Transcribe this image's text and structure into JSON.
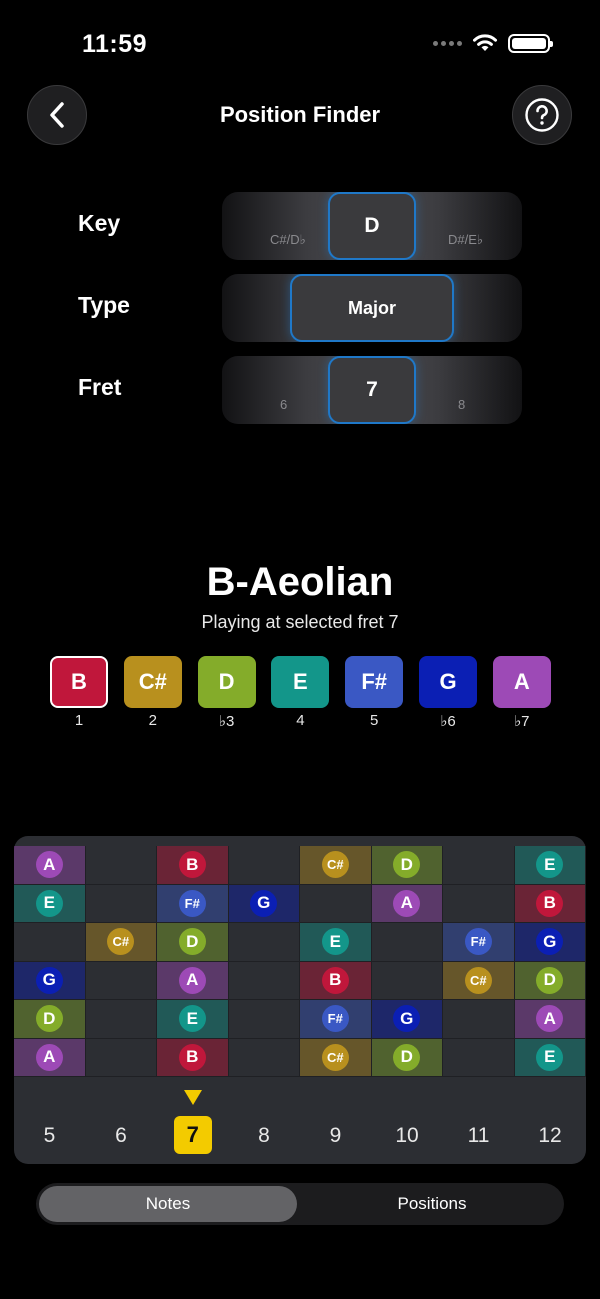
{
  "status": {
    "time": "11:59"
  },
  "header": {
    "title": "Position Finder",
    "back_icon": "chevron-left-icon",
    "help_icon": "question-circle-icon"
  },
  "pickers": [
    {
      "label": "Key",
      "value": "D",
      "prev": "C#/D♭",
      "next": "D#/E♭"
    },
    {
      "label": "Type",
      "value": "Major"
    },
    {
      "label": "Fret",
      "value": "7",
      "prev": "6",
      "next": "8"
    }
  ],
  "scale": {
    "name": "B-Aeolian",
    "subtitle": "Playing at selected fret 7",
    "notes": [
      {
        "note": "B",
        "degree": "1",
        "color": "#c0173b"
      },
      {
        "note": "C#",
        "degree": "2",
        "color": "#b8901e"
      },
      {
        "note": "D",
        "degree": "♭3",
        "color": "#84ac2a"
      },
      {
        "note": "E",
        "degree": "4",
        "color": "#13968a"
      },
      {
        "note": "F#",
        "degree": "5",
        "color": "#3a58c4"
      },
      {
        "note": "G",
        "degree": "♭6",
        "color": "#0b1fb4"
      },
      {
        "note": "A",
        "degree": "♭7",
        "color": "#9d4ab6"
      }
    ]
  },
  "fretboard": {
    "frets": [
      "5",
      "6",
      "7",
      "8",
      "9",
      "10",
      "11",
      "12"
    ],
    "selected_fret": "7",
    "strings": [
      [
        "A",
        "",
        "B",
        "",
        "C#",
        "D",
        "",
        "E"
      ],
      [
        "E",
        "",
        "F#",
        "G",
        "",
        "A",
        "",
        "B"
      ],
      [
        "",
        "C#",
        "D",
        "",
        "E",
        "",
        "F#",
        "G"
      ],
      [
        "G",
        "",
        "A",
        "",
        "B",
        "",
        "C#",
        "D"
      ],
      [
        "D",
        "",
        "E",
        "",
        "F#",
        "G",
        "",
        "A"
      ],
      [
        "A",
        "",
        "B",
        "",
        "C#",
        "D",
        "",
        "E"
      ]
    ]
  },
  "segment": {
    "notes_label": "Notes",
    "positions_label": "Positions",
    "active": "Notes"
  }
}
